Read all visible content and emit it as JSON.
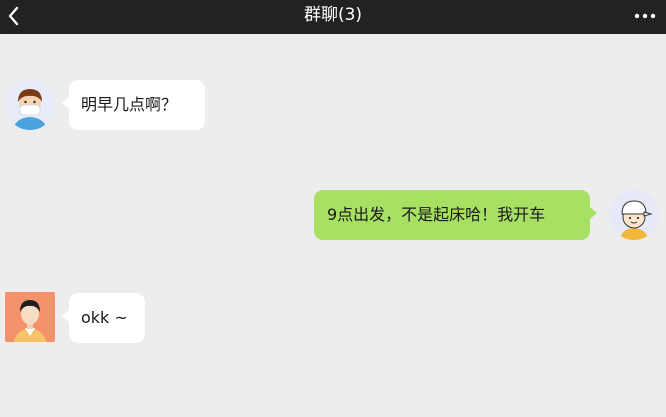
{
  "header": {
    "title": "群聊(3)",
    "back_icon": "chevron-left-icon",
    "more_icon": "more-dots-icon"
  },
  "colors": {
    "header_bg": "#222222",
    "chat_bg": "#ededee",
    "bubble_mine": "#a8e063",
    "bubble_other": "#ffffff"
  },
  "messages": [
    {
      "sender": "other",
      "avatar": "boy-with-mask-avatar",
      "text": "明早几点啊？"
    },
    {
      "sender": "me",
      "avatar": "boy-with-cap-avatar",
      "text": "9点出发，不是起床哈！我开车"
    },
    {
      "sender": "other",
      "avatar": "man-orange-background-avatar",
      "text": "okk ~"
    }
  ]
}
